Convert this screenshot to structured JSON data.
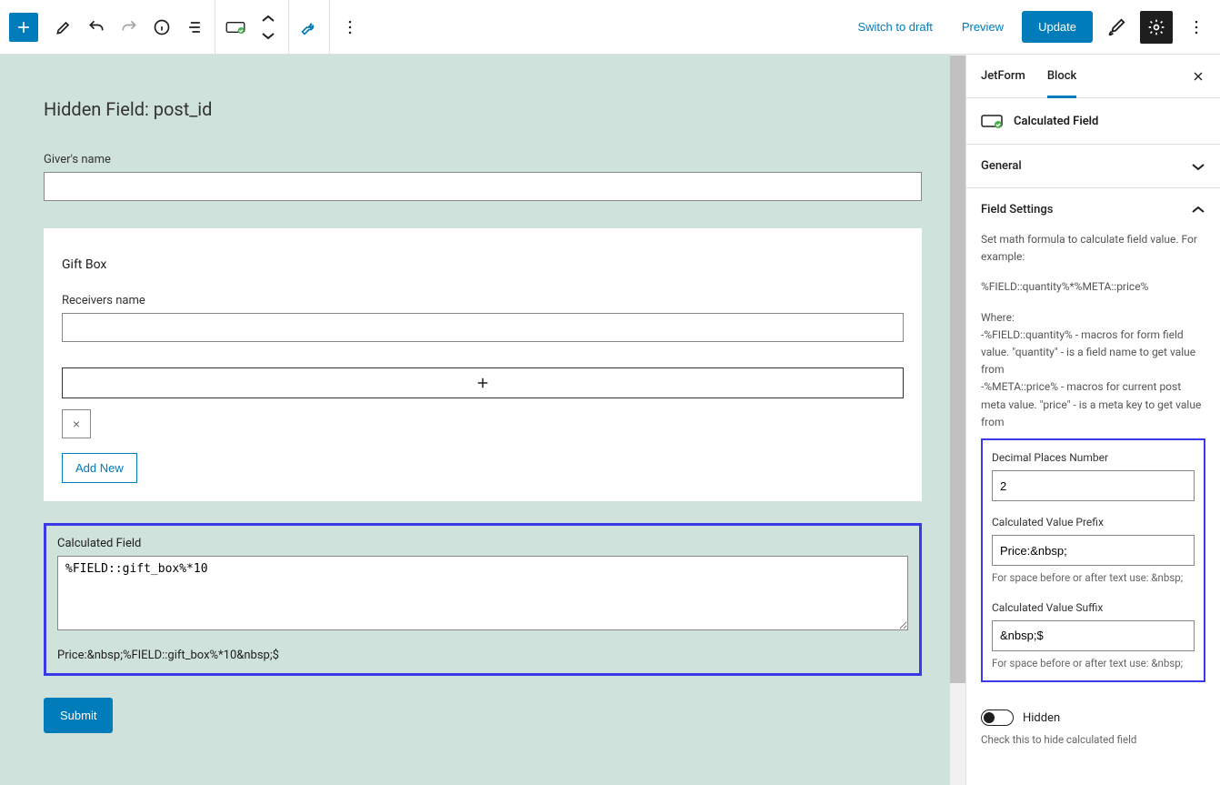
{
  "toolbar": {
    "switch_draft": "Switch to draft",
    "preview": "Preview",
    "update": "Update"
  },
  "canvas": {
    "hidden_field_title": "Hidden Field: post_id",
    "givers_name_label": "Giver's name",
    "gift_box_title": "Gift Box",
    "receivers_name_label": "Receivers name",
    "remove_symbol": "×",
    "add_new": "Add New",
    "calc_label": "Calculated Field",
    "calc_formula": "%FIELD::gift_box%*10",
    "calc_result": "Price:&nbsp;%FIELD::gift_box%*10&nbsp;$",
    "submit": "Submit"
  },
  "sidebar": {
    "tab_jetform": "JetForm",
    "tab_block": "Block",
    "block_title": "Calculated Field",
    "panel_general": "General",
    "panel_field_settings": "Field Settings",
    "help_line1": "Set math formula to calculate field value. For example:",
    "help_formula": "%FIELD::quantity%*%META::price%",
    "help_where": "Where:",
    "help_field_macro": "-%FIELD::quantity% - macros for form field value. \"quantity\" - is a field name to get value from",
    "help_meta_macro": "-%META::price% - macros for current post meta value. \"price\" - is a meta key to get value from",
    "decimal_label": "Decimal Places Number",
    "decimal_value": "2",
    "prefix_label": "Calculated Value Prefix",
    "prefix_value": "Price:&nbsp;",
    "prefix_help": "For space before or after text use: &nbsp;",
    "suffix_label": "Calculated Value Suffix",
    "suffix_value": "&nbsp;$",
    "suffix_help": "For space before or after text use: &nbsp;",
    "hidden_label": "Hidden",
    "hidden_help": "Check this to hide calculated field"
  }
}
